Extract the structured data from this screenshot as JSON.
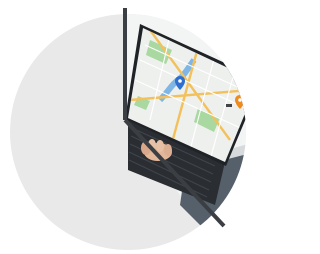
{
  "illustration": {
    "subject": "laptop-showing-map",
    "colors": {
      "background": "#ffffff",
      "circle_fill": "#e9e9e9",
      "divider": "#3b3f44",
      "screen_bezel": "#1f2226",
      "map_land": "#eef0ee",
      "map_park": "#a9d8a0",
      "map_water": "#7fb6e6",
      "map_road_major": "#f2c15c",
      "map_road_minor": "#ffffff",
      "keyboard": "#2a2d31",
      "hand_skin": "#e2b79a",
      "sleeve": "#56606a",
      "pin_blue": "#2f6fd0",
      "pin_orange": "#f08a1c"
    },
    "map": {
      "pins": [
        {
          "name": "location-pin-blue-icon"
        },
        {
          "name": "location-pin-orange-icon"
        }
      ]
    }
  }
}
